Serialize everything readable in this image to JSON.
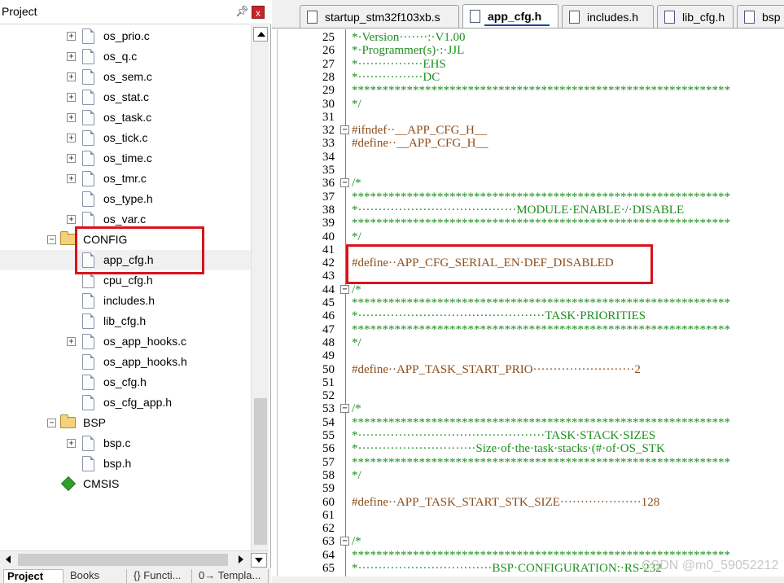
{
  "panel": {
    "title": "Project",
    "pin_icon": "pin-icon",
    "close_label": "x",
    "close_color": "#c8222a"
  },
  "tree": [
    {
      "label": "os_prio.c",
      "kind": "file",
      "expander": "+",
      "level": 2
    },
    {
      "label": "os_q.c",
      "kind": "file",
      "expander": "+",
      "level": 2
    },
    {
      "label": "os_sem.c",
      "kind": "file",
      "expander": "+",
      "level": 2
    },
    {
      "label": "os_stat.c",
      "kind": "file",
      "expander": "+",
      "level": 2
    },
    {
      "label": "os_task.c",
      "kind": "file",
      "expander": "+",
      "level": 2
    },
    {
      "label": "os_tick.c",
      "kind": "file",
      "expander": "+",
      "level": 2
    },
    {
      "label": "os_time.c",
      "kind": "file",
      "expander": "+",
      "level": 2
    },
    {
      "label": "os_tmr.c",
      "kind": "file",
      "expander": "+",
      "level": 2
    },
    {
      "label": "os_type.h",
      "kind": "file",
      "expander": "",
      "level": 2
    },
    {
      "label": "os_var.c",
      "kind": "file",
      "expander": "+",
      "level": 2
    },
    {
      "label": "CONFIG",
      "kind": "folder",
      "expander": "−",
      "level": 1
    },
    {
      "label": "app_cfg.h",
      "kind": "file",
      "expander": "",
      "level": 2,
      "selected": true
    },
    {
      "label": "cpu_cfg.h",
      "kind": "file",
      "expander": "",
      "level": 2
    },
    {
      "label": "includes.h",
      "kind": "file",
      "expander": "",
      "level": 2
    },
    {
      "label": "lib_cfg.h",
      "kind": "file",
      "expander": "",
      "level": 2
    },
    {
      "label": "os_app_hooks.c",
      "kind": "file",
      "expander": "+",
      "level": 2
    },
    {
      "label": "os_app_hooks.h",
      "kind": "file",
      "expander": "",
      "level": 2
    },
    {
      "label": "os_cfg.h",
      "kind": "file",
      "expander": "",
      "level": 2
    },
    {
      "label": "os_cfg_app.h",
      "kind": "file",
      "expander": "",
      "level": 2
    },
    {
      "label": "BSP",
      "kind": "folder",
      "expander": "−",
      "level": 1
    },
    {
      "label": "bsp.c",
      "kind": "file",
      "expander": "+",
      "level": 2
    },
    {
      "label": "bsp.h",
      "kind": "file",
      "expander": "",
      "level": 2
    },
    {
      "label": "CMSIS",
      "kind": "cmsis",
      "expander": "",
      "level": 1
    }
  ],
  "bottom_tabs": [
    {
      "label": "Project",
      "active": true
    },
    {
      "label": "Books",
      "active": false
    },
    {
      "label": "{} Functi...",
      "active": false
    },
    {
      "label": "0→ Templa...",
      "active": false
    }
  ],
  "editor_tabs": [
    {
      "label": "startup_stm32f103xb.s",
      "active": false
    },
    {
      "label": "app_cfg.h",
      "active": true
    },
    {
      "label": "includes.h",
      "active": false
    },
    {
      "label": "lib_cfg.h",
      "active": false
    },
    {
      "label": "bsp",
      "active": false
    }
  ],
  "code_lines": [
    {
      "n": "25",
      "text": "*·Version·······:·V1.00",
      "style": "comment"
    },
    {
      "n": "26",
      "text": "*·Programmer(s)·:·JJL",
      "style": "comment"
    },
    {
      "n": "27",
      "text": "*················EHS",
      "style": "comment"
    },
    {
      "n": "28",
      "text": "*················DC",
      "style": "comment"
    },
    {
      "n": "29",
      "text": "**************************************************************",
      "style": "comment"
    },
    {
      "n": "30",
      "text": "*/",
      "style": "comment"
    },
    {
      "n": "31",
      "text": "",
      "style": "comment"
    },
    {
      "n": "32",
      "text": "#ifndef··__APP_CFG_H__",
      "style": "pre",
      "fold": "−"
    },
    {
      "n": "33",
      "text": "#define··__APP_CFG_H__",
      "style": "pre"
    },
    {
      "n": "34",
      "text": "",
      "style": "comment"
    },
    {
      "n": "35",
      "text": "",
      "style": "comment"
    },
    {
      "n": "36",
      "text": "/*",
      "style": "comment",
      "fold": "−"
    },
    {
      "n": "37",
      "text": "**************************************************************",
      "style": "comment"
    },
    {
      "n": "38",
      "text": "*·······································MODULE·ENABLE·/·DISABLE",
      "style": "comment"
    },
    {
      "n": "39",
      "text": "**************************************************************",
      "style": "comment"
    },
    {
      "n": "40",
      "text": "*/",
      "style": "comment"
    },
    {
      "n": "41",
      "text": "",
      "style": "comment"
    },
    {
      "n": "42",
      "text": "#define··APP_CFG_SERIAL_EN·DEF_DISABLED",
      "style": "pre"
    },
    {
      "n": "43",
      "text": "",
      "style": "comment"
    },
    {
      "n": "44",
      "text": "/*",
      "style": "comment",
      "fold": "−"
    },
    {
      "n": "45",
      "text": "**************************************************************",
      "style": "comment"
    },
    {
      "n": "46",
      "text": "*··············································TASK·PRIORITIES",
      "style": "comment"
    },
    {
      "n": "47",
      "text": "**************************************************************",
      "style": "comment"
    },
    {
      "n": "48",
      "text": "*/",
      "style": "comment"
    },
    {
      "n": "49",
      "text": "",
      "style": "comment"
    },
    {
      "n": "50",
      "text": "#define··APP_TASK_START_PRIO·························2",
      "style": "pre"
    },
    {
      "n": "51",
      "text": "",
      "style": "comment"
    },
    {
      "n": "52",
      "text": "",
      "style": "comment"
    },
    {
      "n": "53",
      "text": "/*",
      "style": "comment",
      "fold": "−"
    },
    {
      "n": "54",
      "text": "**************************************************************",
      "style": "comment"
    },
    {
      "n": "55",
      "text": "*··············································TASK·STACK·SIZES",
      "style": "comment"
    },
    {
      "n": "56",
      "text": "*·····························Size·of·the·task·stacks·(#·of·OS_STK",
      "style": "comment"
    },
    {
      "n": "57",
      "text": "**************************************************************",
      "style": "comment"
    },
    {
      "n": "58",
      "text": "*/",
      "style": "comment"
    },
    {
      "n": "59",
      "text": "",
      "style": "comment"
    },
    {
      "n": "60",
      "text": "#define··APP_TASK_START_STK_SIZE····················128",
      "style": "pre"
    },
    {
      "n": "61",
      "text": "",
      "style": "comment"
    },
    {
      "n": "62",
      "text": "",
      "style": "comment"
    },
    {
      "n": "63",
      "text": "/*",
      "style": "comment",
      "fold": "−"
    },
    {
      "n": "64",
      "text": "**************************************************************",
      "style": "comment"
    },
    {
      "n": "65",
      "text": "*·································BSP·CONFIGURATION:·RS-232",
      "style": "comment"
    }
  ],
  "watermark": "CSDN @m0_59052212",
  "colors": {
    "comment": "#1f8f1f",
    "preprocessor": "#8c4d1a",
    "annotation": "#d7141d",
    "folder": "#f3d27a"
  }
}
